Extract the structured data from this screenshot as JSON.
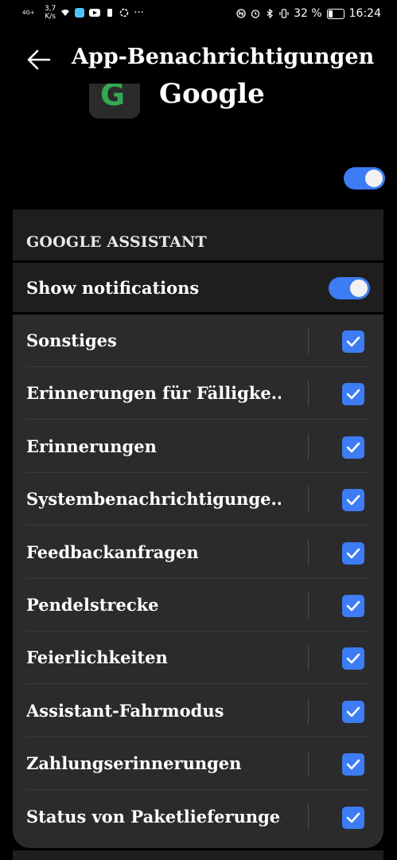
{
  "status_bar": {
    "network": "4G+",
    "speed": "3,7\nK/s",
    "battery_percent": "32 %",
    "battery_level": 0.32,
    "time": "16:24",
    "icons": [
      "signal-icon",
      "wifi-icon",
      "app-icon",
      "youtube-icon",
      "sim-icon",
      "loading-icon",
      "more-icon",
      "nfc-icon",
      "alarm-icon",
      "bluetooth-icon",
      "vibrate-icon",
      "battery-icon"
    ]
  },
  "header": {
    "title": "App-Benachrichtigungen",
    "back_icon": "arrow-left-icon"
  },
  "app": {
    "name": "Google",
    "icon_letter": "G"
  },
  "main_toggle": {
    "on": true
  },
  "section": {
    "label": "GOOGLE ASSISTANT"
  },
  "show_notifications": {
    "label": "Show notifications",
    "on": true
  },
  "channels": [
    {
      "label": "Sonstiges",
      "checked": true
    },
    {
      "label": "Erinnerungen für Fälligke..",
      "checked": true
    },
    {
      "label": "Erinnerungen",
      "checked": true
    },
    {
      "label": "Systembenachrichtigunge..",
      "checked": true
    },
    {
      "label": "Feedbackanfragen",
      "checked": true
    },
    {
      "label": "Pendelstrecke",
      "checked": true
    },
    {
      "label": "Feierlichkeiten",
      "checked": true
    },
    {
      "label": "Assistant-Fahrmodus",
      "checked": true
    },
    {
      "label": "Zahlungserinnerungen",
      "checked": true
    },
    {
      "label": "Status von Paketlieferungen",
      "checked": true
    }
  ],
  "colors": {
    "accent": "#3d7cf4",
    "background": "#000000",
    "card": "#2b2b2d",
    "google_green": "#34a853"
  }
}
